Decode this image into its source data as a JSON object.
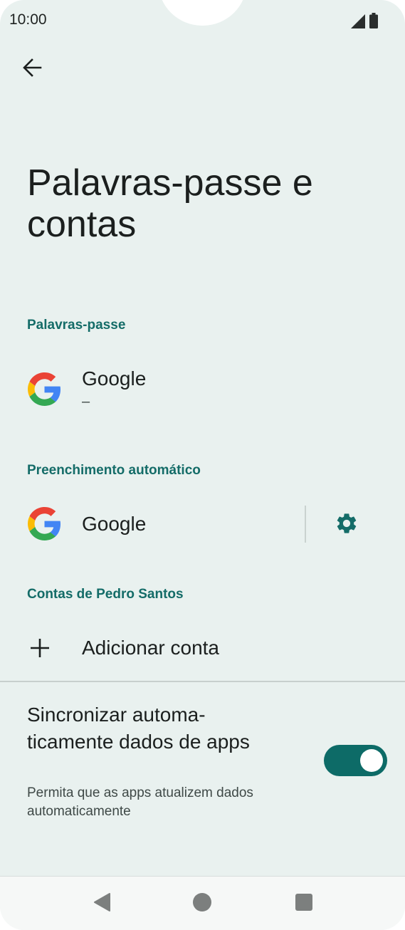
{
  "status_bar": {
    "time": "10:00",
    "icons": [
      "signal-icon",
      "battery-icon"
    ]
  },
  "header": {
    "back_icon": "arrow-left-icon",
    "title": "Palavras-passe e contas"
  },
  "passwords_section": {
    "header": "Palavras-passe",
    "item": {
      "icon": "google-logo-icon",
      "title": "Google",
      "subtitle": "–"
    }
  },
  "autofill_section": {
    "header": "Preenchimento automático",
    "item": {
      "icon": "google-logo-icon",
      "title": "Google",
      "settings_icon": "gear-icon"
    }
  },
  "accounts_section": {
    "header": "Contas de Pedro Santos",
    "add_account": {
      "icon": "plus-icon",
      "label": "Adicionar conta"
    }
  },
  "sync_setting": {
    "title": "Sincronizar automa­ticamente dados de apps",
    "subtitle": "Permita que as apps atualizem dados automaticamente",
    "enabled": true
  },
  "nav_bar": {
    "buttons": [
      "back-triangle-icon",
      "home-circle-icon",
      "recents-square-icon"
    ]
  },
  "colors": {
    "background": "#e9f1ef",
    "accent": "#146c68",
    "toggle_on": "#0d6b67",
    "text_primary": "#1b1f1e",
    "text_secondary": "#3f4947"
  }
}
